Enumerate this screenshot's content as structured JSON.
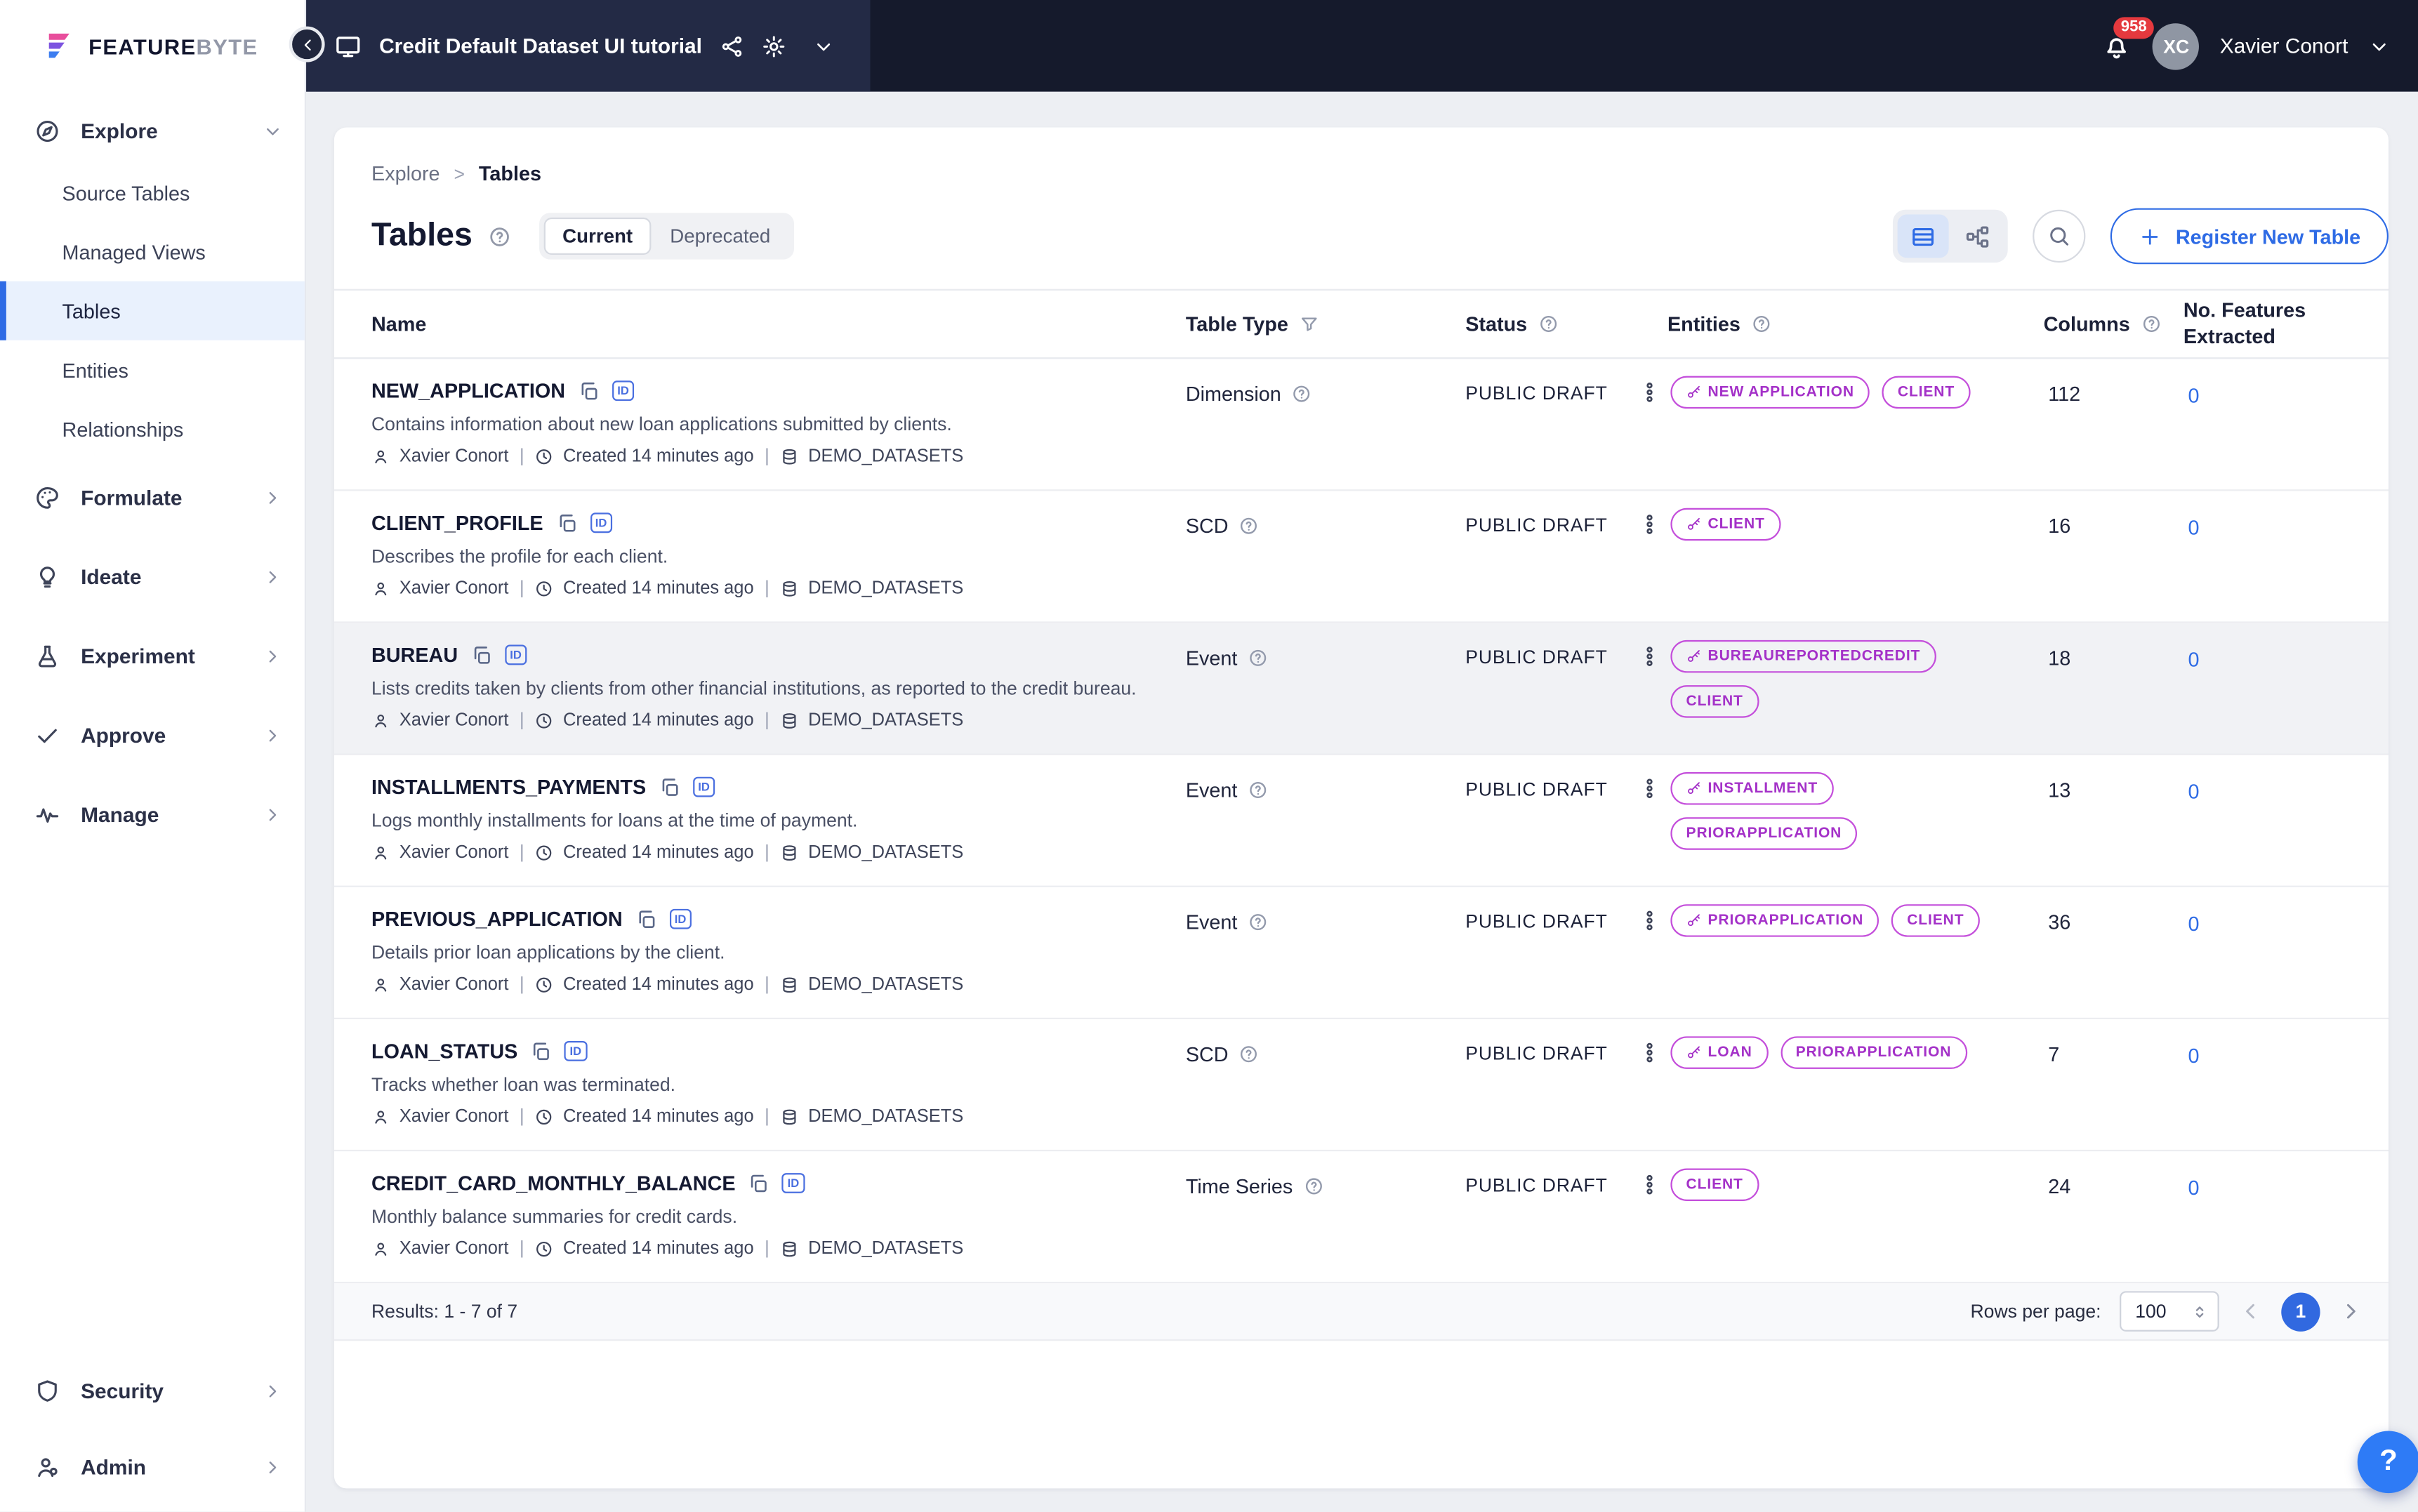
{
  "brand": {
    "feature": "FEATURE",
    "byte": "BYTE"
  },
  "topbar": {
    "project_title": "Credit Default Dataset UI tutorial",
    "notification_count": "958",
    "user_initials": "XC",
    "user_name": "Xavier Conort"
  },
  "sidebar": {
    "explore": {
      "label": "Explore"
    },
    "explore_items": [
      {
        "label": "Source Tables",
        "active": false
      },
      {
        "label": "Managed Views",
        "active": false
      },
      {
        "label": "Tables",
        "active": true
      },
      {
        "label": "Entities",
        "active": false
      },
      {
        "label": "Relationships",
        "active": false
      }
    ],
    "sections": [
      {
        "label": "Formulate"
      },
      {
        "label": "Ideate"
      },
      {
        "label": "Experiment"
      },
      {
        "label": "Approve"
      },
      {
        "label": "Manage"
      }
    ],
    "bottom": [
      {
        "label": "Security"
      },
      {
        "label": "Admin"
      }
    ]
  },
  "breadcrumb": {
    "parent": "Explore",
    "separator": ">",
    "current": "Tables"
  },
  "page": {
    "title": "Tables",
    "tab_current": "Current",
    "tab_deprecated": "Deprecated",
    "register_button": "Register New Table",
    "help_button": "?"
  },
  "table": {
    "headers": {
      "name": "Name",
      "type": "Table Type",
      "status": "Status",
      "entities": "Entities",
      "columns": "Columns",
      "features": "No. Features Extracted"
    },
    "id_badge_label": "ID",
    "meta_separator": "|",
    "rows": [
      {
        "name": "NEW_APPLICATION",
        "description": "Contains information about new loan applications submitted by clients.",
        "owner": "Xavier Conort",
        "created": "Created 14 minutes ago",
        "catalog": "DEMO_DATASETS",
        "type": "Dimension",
        "status": "PUBLIC DRAFT",
        "entities": [
          {
            "label": "NEW APPLICATION",
            "primary": true
          },
          {
            "label": "CLIENT",
            "primary": false
          }
        ],
        "columns": "112",
        "features": "0"
      },
      {
        "name": "CLIENT_PROFILE",
        "description": "Describes the profile for each client.",
        "owner": "Xavier Conort",
        "created": "Created 14 minutes ago",
        "catalog": "DEMO_DATASETS",
        "type": "SCD",
        "status": "PUBLIC DRAFT",
        "entities": [
          {
            "label": "CLIENT",
            "primary": true
          }
        ],
        "columns": "16",
        "features": "0"
      },
      {
        "name": "BUREAU",
        "description": "Lists credits taken by clients from other financial institutions, as reported to the credit bureau.",
        "owner": "Xavier Conort",
        "created": "Created 14 minutes ago",
        "catalog": "DEMO_DATASETS",
        "type": "Event",
        "status": "PUBLIC DRAFT",
        "entities": [
          {
            "label": "BUREAUREPORTEDCREDIT",
            "primary": true
          },
          {
            "label": "CLIENT",
            "primary": false
          }
        ],
        "columns": "18",
        "features": "0"
      },
      {
        "name": "INSTALLMENTS_PAYMENTS",
        "description": "Logs monthly installments for loans at the time of payment.",
        "owner": "Xavier Conort",
        "created": "Created 14 minutes ago",
        "catalog": "DEMO_DATASETS",
        "type": "Event",
        "status": "PUBLIC DRAFT",
        "entities": [
          {
            "label": "INSTALLMENT",
            "primary": true
          },
          {
            "label": "PRIORAPPLICATION",
            "primary": false
          }
        ],
        "columns": "13",
        "features": "0"
      },
      {
        "name": "PREVIOUS_APPLICATION",
        "description": "Details prior loan applications by the client.",
        "owner": "Xavier Conort",
        "created": "Created 14 minutes ago",
        "catalog": "DEMO_DATASETS",
        "type": "Event",
        "status": "PUBLIC DRAFT",
        "entities": [
          {
            "label": "PRIORAPPLICATION",
            "primary": true
          },
          {
            "label": "CLIENT",
            "primary": false
          }
        ],
        "columns": "36",
        "features": "0"
      },
      {
        "name": "LOAN_STATUS",
        "description": "Tracks whether loan was terminated.",
        "owner": "Xavier Conort",
        "created": "Created 14 minutes ago",
        "catalog": "DEMO_DATASETS",
        "type": "SCD",
        "status": "PUBLIC DRAFT",
        "entities": [
          {
            "label": "LOAN",
            "primary": true
          },
          {
            "label": "PRIORAPPLICATION",
            "primary": false
          }
        ],
        "columns": "7",
        "features": "0"
      },
      {
        "name": "CREDIT_CARD_MONTHLY_BALANCE",
        "description": "Monthly balance summaries for credit cards.",
        "owner": "Xavier Conort",
        "created": "Created 14 minutes ago",
        "catalog": "DEMO_DATASETS",
        "type": "Time Series",
        "status": "PUBLIC DRAFT",
        "entities": [
          {
            "label": "CLIENT",
            "primary": false
          }
        ],
        "columns": "24",
        "features": "0"
      }
    ]
  },
  "footer": {
    "results": "Results: 1 - 7 of 7",
    "rows_per_page_label": "Rows per page:",
    "rows_per_page_value": "100",
    "page": "1"
  },
  "colors": {
    "accent_blue": "#2e6be5",
    "entity_purple": "#b13fd2",
    "badge_red": "#e5393e",
    "topbar_navy": "#151a2c"
  }
}
